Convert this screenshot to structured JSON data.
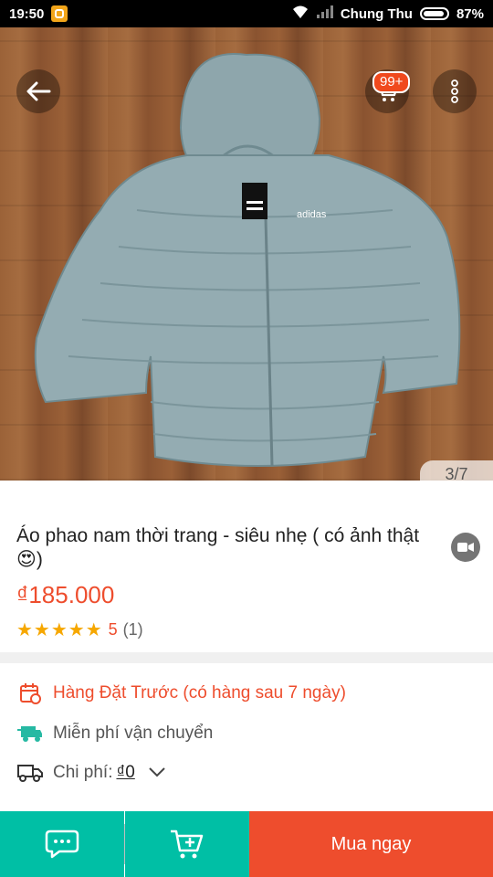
{
  "status_bar": {
    "time": "19:50",
    "carrier": "Chung Thu",
    "battery": "87%"
  },
  "hero": {
    "image_counter": "3/7",
    "cart_badge": "99+",
    "logo_text": "adidas"
  },
  "product": {
    "title": "Áo phao nam thời trang - siêu nhẹ ( có ảnh thật 😍)",
    "price": "₫185.000",
    "rating_score": "5",
    "rating_count": "(1)",
    "stars": "★★★★★"
  },
  "info": {
    "preorder": "Hàng Đặt Trước (có hàng sau 7 ngày)",
    "shipping": "Miễn phí vận chuyển",
    "cost_label": "Chi phí:",
    "cost_value": "₫0"
  },
  "bottom": {
    "buy_now": "Mua ngay"
  },
  "colors": {
    "accent": "#ee4d2d",
    "teal": "#00bfa5",
    "star": "#f6a700"
  },
  "icons": [
    "back-arrow-icon",
    "cart-icon",
    "more-vertical-icon",
    "video-icon",
    "calendar-icon",
    "free-shipping-icon",
    "truck-icon",
    "chevron-down-icon",
    "chat-icon",
    "add-to-cart-icon"
  ]
}
